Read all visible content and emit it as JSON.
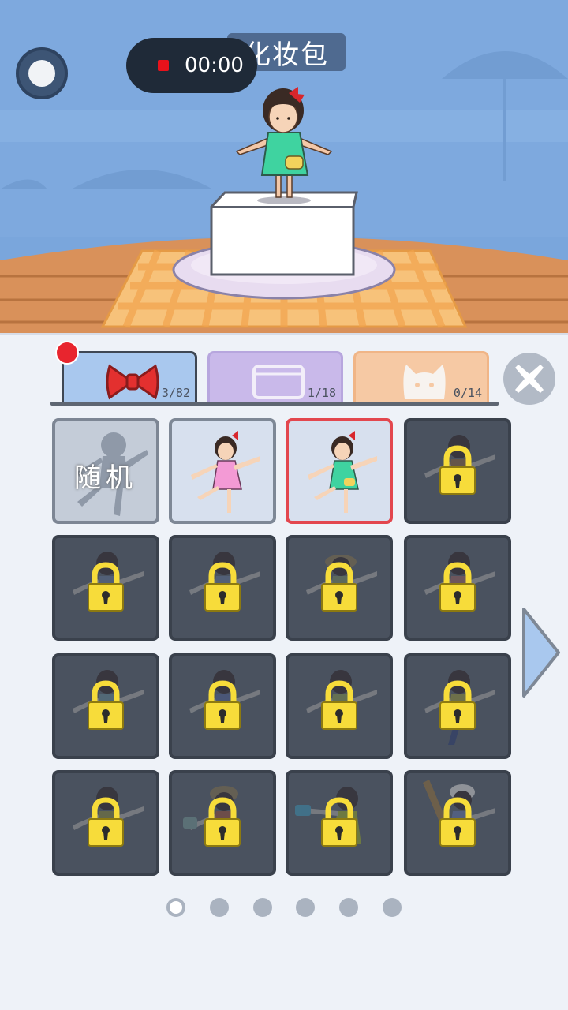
{
  "header": {
    "timer": "00:00",
    "level_title": "化妆包"
  },
  "tabs": [
    {
      "name": "accessories",
      "icon": "bow-icon",
      "count": "3/82",
      "color": "#a9c8ee"
    },
    {
      "name": "boxes",
      "icon": "box-icon",
      "count": "1/18",
      "color": "#c9b9ea"
    },
    {
      "name": "pets",
      "icon": "cat-icon",
      "count": "0/14",
      "color": "#f6c9a4"
    }
  ],
  "grid": {
    "random_label": "随机",
    "items": [
      {
        "state": "random"
      },
      {
        "state": "unlocked",
        "outfit": "pink dress"
      },
      {
        "state": "selected",
        "outfit": "green dress"
      },
      {
        "state": "locked"
      },
      {
        "state": "locked"
      },
      {
        "state": "locked"
      },
      {
        "state": "locked"
      },
      {
        "state": "locked"
      },
      {
        "state": "locked"
      },
      {
        "state": "locked"
      },
      {
        "state": "locked"
      },
      {
        "state": "locked"
      },
      {
        "state": "locked"
      },
      {
        "state": "locked"
      },
      {
        "state": "locked"
      },
      {
        "state": "locked"
      }
    ]
  },
  "pagination": {
    "pages": 6,
    "current": 1
  },
  "colors": {
    "locked_cell": "#4a525f",
    "selected_border": "#e3474e",
    "lock_yellow": "#f7dc3a"
  }
}
